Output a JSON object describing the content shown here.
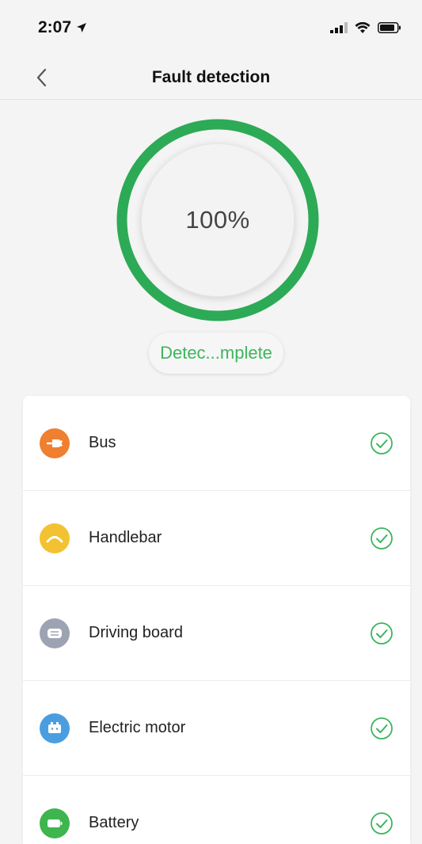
{
  "status_bar": {
    "time": "2:07",
    "icons": [
      "location-arrow-icon",
      "signal-icon",
      "wifi-icon",
      "battery-icon"
    ]
  },
  "nav": {
    "title": "Fault detection",
    "back_icon": "chevron-left-icon"
  },
  "progress": {
    "value": 100,
    "label": "100%",
    "ring_color": "#2daa55"
  },
  "status_label": "Detec...mplete",
  "colors": {
    "accent_green": "#3db55f",
    "bus": "#f07f30",
    "handlebar": "#f2c232",
    "driving_board": "#9ea3b4",
    "electric_motor": "#4a9ee0",
    "battery": "#3fb54d"
  },
  "items": [
    {
      "label": "Bus",
      "icon": "plug-icon",
      "status": "check-circle-icon"
    },
    {
      "label": "Handlebar",
      "icon": "handlebar-icon",
      "status": "check-circle-icon"
    },
    {
      "label": "Driving board",
      "icon": "driving-board-icon",
      "status": "check-circle-icon"
    },
    {
      "label": "Electric motor",
      "icon": "motor-icon",
      "status": "check-circle-icon"
    },
    {
      "label": "Battery",
      "icon": "battery-icon",
      "status": "check-circle-icon"
    }
  ]
}
